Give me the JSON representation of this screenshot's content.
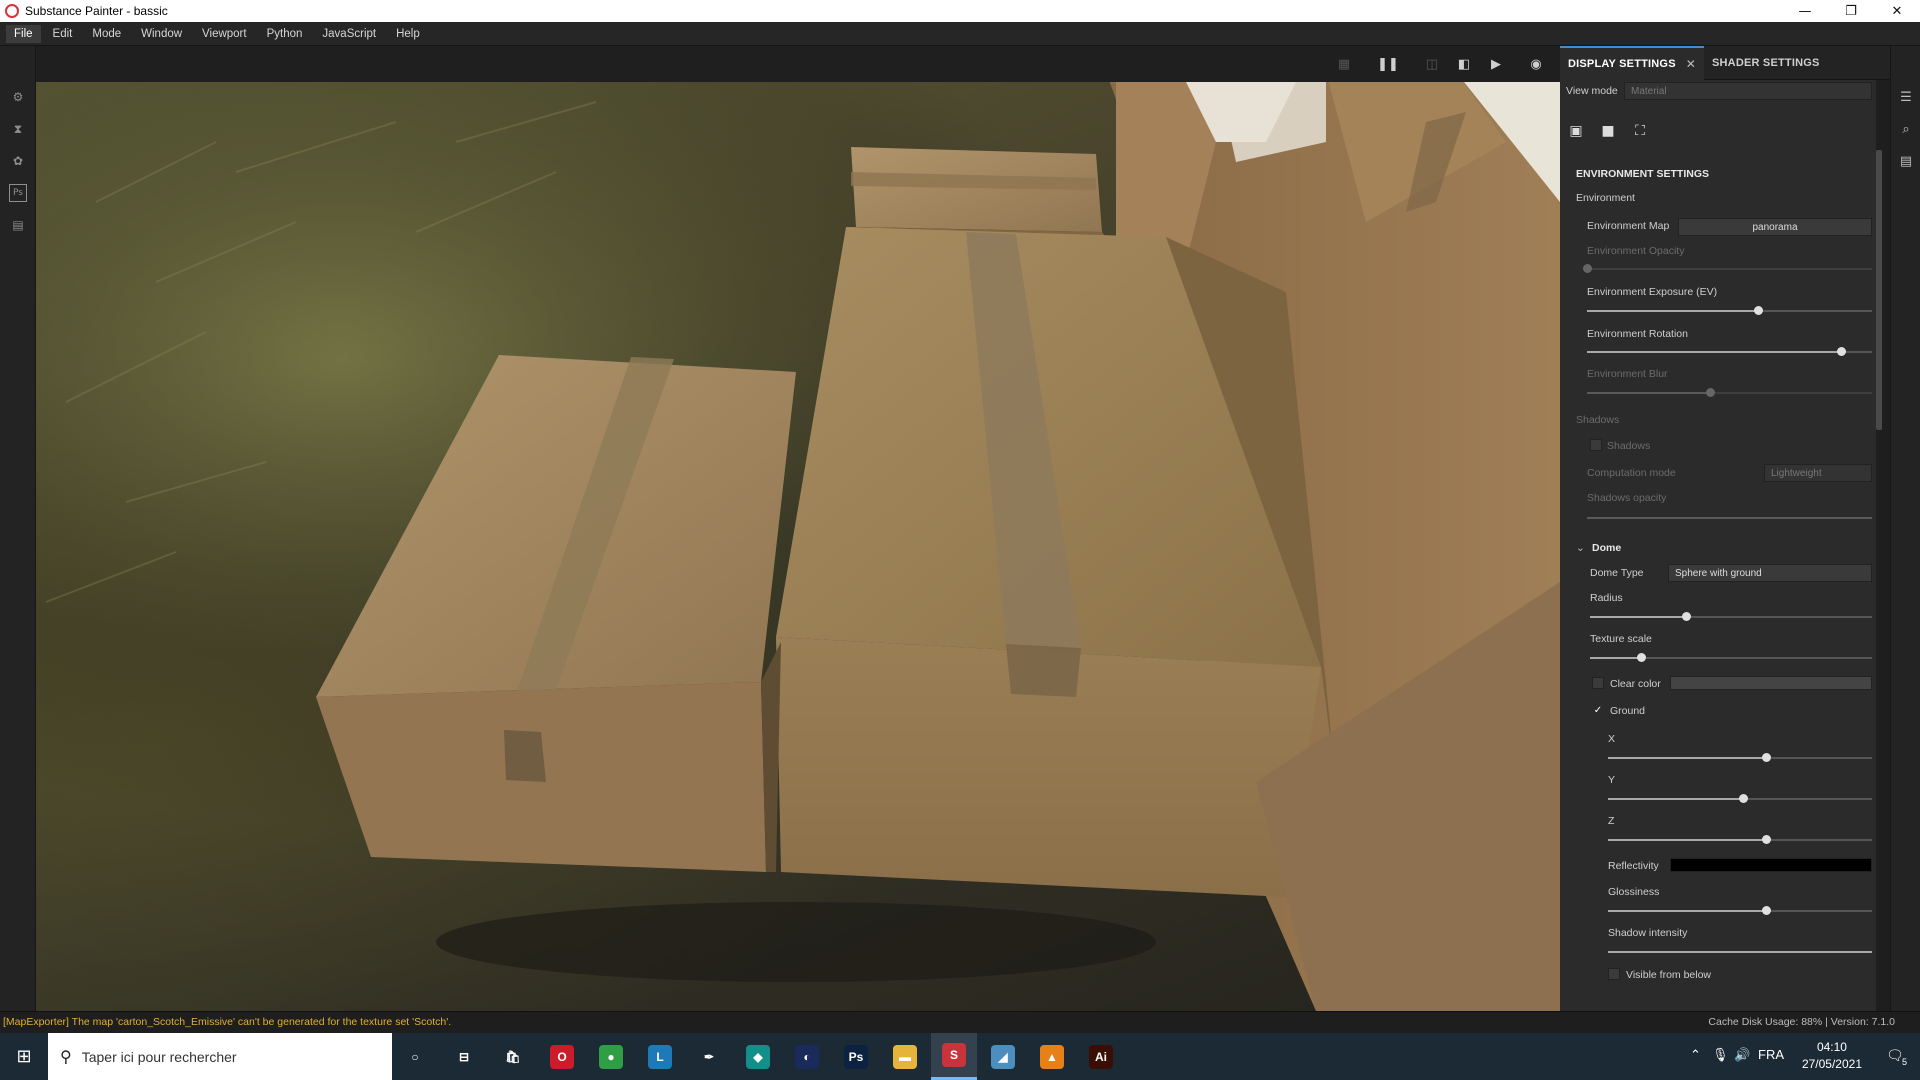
{
  "window": {
    "title": "Substance Painter - bassic",
    "minimize": "—",
    "maximize": "❐",
    "close": "✕"
  },
  "menu": [
    "File",
    "Edit",
    "Mode",
    "Window",
    "Viewport",
    "Python",
    "JavaScript",
    "Help"
  ],
  "dock": {
    "tabs": [
      {
        "label": "DISPLAY SETTINGS",
        "close": "✕"
      },
      {
        "label": "SHADER SETTINGS"
      }
    ]
  },
  "display": {
    "view_mode_label": "View mode",
    "view_mode_value": "Material",
    "section_title": "ENVIRONMENT SETTINGS",
    "environment_group": "Environment",
    "environment_map_label": "Environment Map",
    "environment_map_value": "panorama",
    "environment_opacity_label": "Environment Opacity",
    "environment_opacity_value": 0.0,
    "environment_exposure_label": "Environment Exposure (EV)",
    "environment_exposure_value": 0.6,
    "environment_rotation_label": "Environment Rotation",
    "environment_rotation_value": 0.89,
    "environment_blur_label": "Environment Blur",
    "environment_blur_value": 0.43,
    "shadows_group": "Shadows",
    "shadows_label": "Shadows",
    "shadows_checked": false,
    "computation_mode_label": "Computation mode",
    "computation_mode_value": "Lightweight",
    "shadows_opacity_label": "Shadows opacity",
    "shadows_opacity_value": 1.0,
    "dome_group": "Dome",
    "dome_type_label": "Dome Type",
    "dome_type_value": "Sphere with ground",
    "radius_label": "Radius",
    "radius_value": 0.34,
    "texture_scale_label": "Texture scale",
    "texture_scale_value": 0.18,
    "clear_color_label": "Clear color",
    "clear_color_checked": false,
    "ground_label": "Ground",
    "ground_checked": true,
    "x_label": "X",
    "x_value": 0.6,
    "y_label": "Y",
    "y_value": 0.51,
    "z_label": "Z",
    "z_value": 0.6,
    "reflectivity_label": "Reflectivity",
    "reflectivity_color": "#000000",
    "glossiness_label": "Glossiness",
    "glossiness_value": 0.6,
    "shadow_intensity_label": "Shadow intensity",
    "shadow_intensity_value": 1.0,
    "visible_below_label": "Visible from below",
    "visible_below_checked": false
  },
  "status": {
    "message": "[MapExporter] The map 'carton_Scotch_Emissive' can't be generated for the texture set 'Scotch'.",
    "right": "Cache Disk Usage:   88% | Version: 7.1.0"
  },
  "taskbar": {
    "search_placeholder": "Taper ici pour rechercher",
    "language": "FRA",
    "time": "04:10",
    "date": "27/05/2021",
    "notifications": "5",
    "apps": [
      {
        "name": "cortana",
        "glyph": "○",
        "color": "transparent"
      },
      {
        "name": "task-view",
        "glyph": "⊟",
        "color": "transparent"
      },
      {
        "name": "store",
        "glyph": "🛍",
        "color": "transparent"
      },
      {
        "name": "opera",
        "glyph": "O",
        "color": "#cc1b2b"
      },
      {
        "name": "chrome",
        "glyph": "●",
        "color": "#2f9e44"
      },
      {
        "name": "app-l",
        "glyph": "L",
        "color": "#1d79b8"
      },
      {
        "name": "pen-tool",
        "glyph": "✒",
        "color": "transparent"
      },
      {
        "name": "app-cube",
        "glyph": "◆",
        "color": "#138f8a"
      },
      {
        "name": "cinema4d",
        "glyph": "◐",
        "color": "#1a2a5a"
      },
      {
        "name": "photoshop",
        "glyph": "Ps",
        "color": "#0b2340"
      },
      {
        "name": "file-explorer",
        "glyph": "▬",
        "color": "#e5b43a"
      },
      {
        "name": "substance-painter",
        "glyph": "S",
        "color": "#c9333c"
      },
      {
        "name": "app-paper",
        "glyph": "◢",
        "color": "#4c8fbf"
      },
      {
        "name": "vlc",
        "glyph": "▲",
        "color": "#e8801a"
      },
      {
        "name": "illustrator",
        "glyph": "Ai",
        "color": "#3a0d05"
      }
    ]
  }
}
